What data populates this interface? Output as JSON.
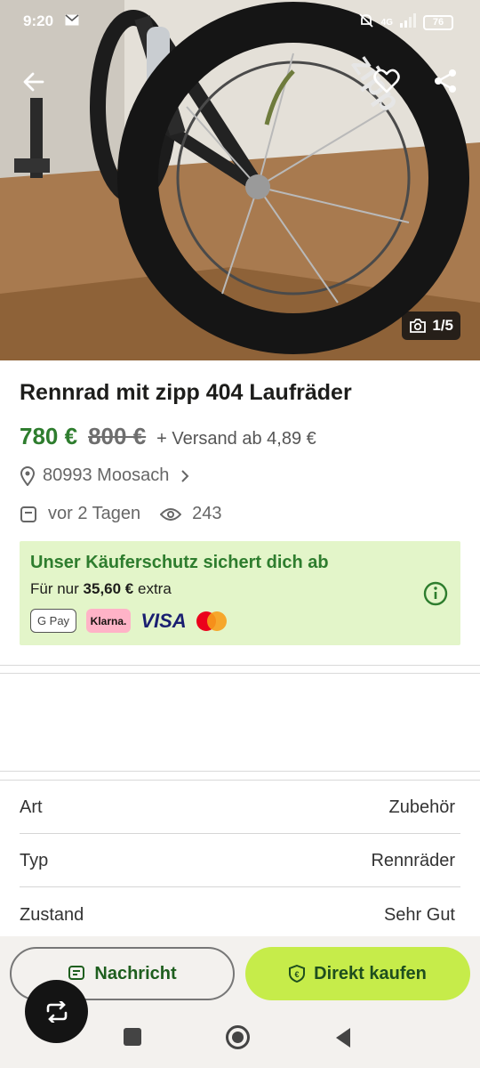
{
  "status": {
    "time": "9:20",
    "network": "4G",
    "battery": "76"
  },
  "gallery": {
    "counter": "1/5"
  },
  "listing": {
    "title": "Rennrad mit zipp 404 Laufräder",
    "price": "780 €",
    "old_price": "800 €",
    "shipping": "+ Versand ab 4,89 €",
    "location": "80993 Moosach",
    "posted": "vor 2 Tagen",
    "views": "243"
  },
  "protection": {
    "heading": "Unser Käuferschutz sichert dich ab",
    "prefix": "Für nur",
    "amount": "35,60 €",
    "suffix": "extra",
    "payments": {
      "gpay": "G Pay",
      "klarna": "Klarna.",
      "visa": "VISA"
    }
  },
  "attributes": [
    {
      "key": "Art",
      "value": "Zubehör"
    },
    {
      "key": "Typ",
      "value": "Rennräder"
    },
    {
      "key": "Zustand",
      "value": "Sehr Gut"
    }
  ],
  "actions": {
    "message": "Nachricht",
    "buy": "Direkt kaufen"
  },
  "colors": {
    "accent_green": "#2e7d2e",
    "buy_button": "#c6ec4a",
    "protection_bg": "#e3f5c9"
  }
}
